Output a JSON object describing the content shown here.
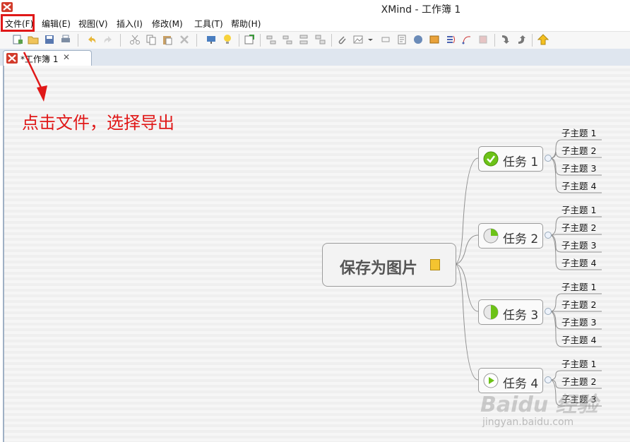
{
  "window": {
    "title": "XMind - 工作簿 1"
  },
  "menu": {
    "items": [
      "文件(F)",
      "编辑(E)",
      "视图(V)",
      "插入(I)",
      "修改(M)",
      "工具(T)",
      "帮助(H)"
    ]
  },
  "tab": {
    "label": "*工作簿 1",
    "close": "✕"
  },
  "annotation": {
    "text": "点击文件，选择导出"
  },
  "mindmap": {
    "central_topic": "保存为图片",
    "tasks": [
      {
        "label": "任务 1",
        "marker": "check",
        "subtopics": [
          "子主题 1",
          "子主题 2",
          "子主题 3",
          "子主题 4"
        ]
      },
      {
        "label": "任务 2",
        "marker": "quarter",
        "subtopics": [
          "子主题 1",
          "子主题 2",
          "子主题 3",
          "子主题 4"
        ]
      },
      {
        "label": "任务 3",
        "marker": "half",
        "subtopics": [
          "子主题 1",
          "子主题 2",
          "子主题 3",
          "子主题 4"
        ]
      },
      {
        "label": "任务 4",
        "marker": "play",
        "subtopics": [
          "子主题 1",
          "子主题 2",
          "子主题 3"
        ]
      }
    ]
  },
  "watermark": {
    "brand": "Baidu 经验",
    "url": "jingyan.baidu.com"
  },
  "colors": {
    "annotation": "#e01818",
    "marker_green": "#6cc217",
    "tab_border": "#9fb0c4"
  }
}
